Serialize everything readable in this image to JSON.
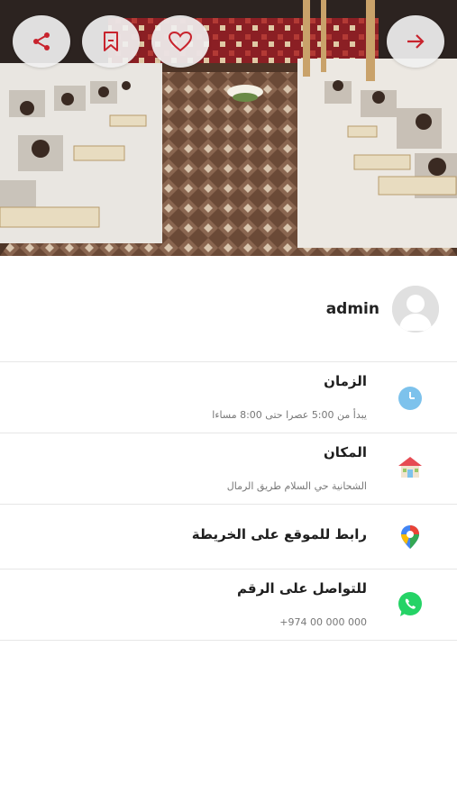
{
  "header": {
    "share_icon": "share-icon",
    "bookmark_icon": "bookmark-icon",
    "favorite_icon": "heart-icon",
    "back_icon": "arrow-right-icon",
    "accent": "#c8232d"
  },
  "host": {
    "name": "admin"
  },
  "details": {
    "time": {
      "title": "الزمان",
      "value": "يبدأ من 5:00 عصرا حتى 8:00 مساءا"
    },
    "place": {
      "title": "المكان",
      "value": "الشحانية حي السلام طريق الرمال"
    },
    "map": {
      "title": "رابط للموقع على الخريطة"
    },
    "contact": {
      "title": "للتواصل على الرقم",
      "value": "+974 00 000 000"
    }
  }
}
